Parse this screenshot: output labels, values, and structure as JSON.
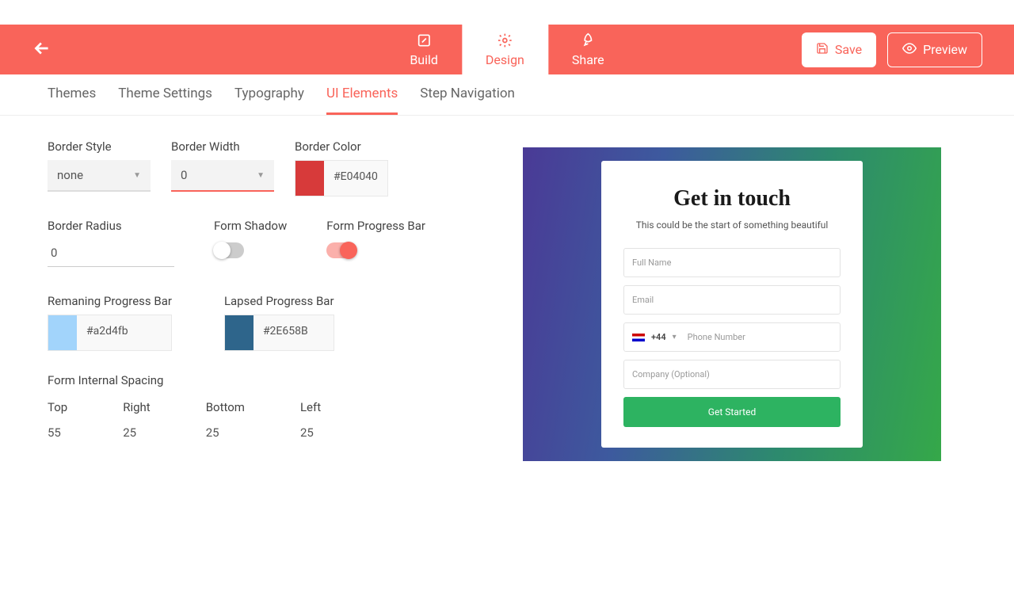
{
  "header": {
    "tabs": [
      {
        "label": "Build",
        "icon": "edit-icon"
      },
      {
        "label": "Design",
        "icon": "gear-icon"
      },
      {
        "label": "Share",
        "icon": "rocket-icon"
      }
    ],
    "save_label": "Save",
    "preview_label": "Preview"
  },
  "subnav": {
    "items": [
      "Themes",
      "Theme Settings",
      "Typography",
      "UI Elements",
      "Step Navigation"
    ],
    "active_index": 3
  },
  "panel": {
    "border_style": {
      "label": "Border Style",
      "value": "none"
    },
    "border_width": {
      "label": "Border Width",
      "value": "0"
    },
    "border_color": {
      "label": "Border Color",
      "hex": "#E04040",
      "swatch": "#d73a3a"
    },
    "border_radius": {
      "label": "Border Radius",
      "value": "0"
    },
    "form_shadow": {
      "label": "Form Shadow",
      "on": false
    },
    "form_progress": {
      "label": "Form Progress Bar",
      "on": true
    },
    "remaining": {
      "label": "Remaning Progress Bar",
      "hex": "#a2d4fb",
      "swatch": "#a2d4fb"
    },
    "lapsed": {
      "label": "Lapsed Progress Bar",
      "hex": "#2E658B",
      "swatch": "#2E658B"
    },
    "spacing": {
      "label": "Form Internal Spacing",
      "top": {
        "label": "Top",
        "value": "55"
      },
      "right": {
        "label": "Right",
        "value": "25"
      },
      "bottom": {
        "label": "Bottom",
        "value": "25"
      },
      "left": {
        "label": "Left",
        "value": "25"
      }
    }
  },
  "preview": {
    "title": "Get in touch",
    "subtitle": "This could be the start of something beautiful",
    "fields": {
      "fullname": "Full Name",
      "email": "Email",
      "phone_prefix": "+44",
      "phone": "Phone Number",
      "company": "Company (Optional)"
    },
    "submit": "Get Started"
  }
}
